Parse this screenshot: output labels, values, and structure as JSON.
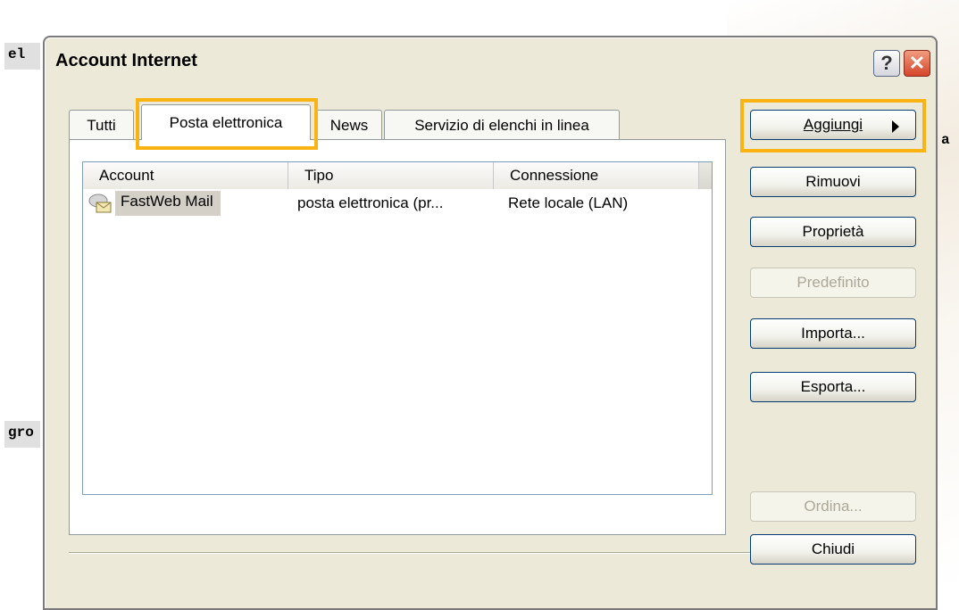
{
  "background": {
    "text_top_left": "el",
    "text_mid_left": "gro",
    "text_right": "a"
  },
  "dialog": {
    "title": "Account Internet",
    "help_label": "?",
    "close_label": "✕"
  },
  "tabs": [
    {
      "label": "Tutti"
    },
    {
      "label": "Posta elettronica"
    },
    {
      "label": "News"
    },
    {
      "label": "Servizio di elenchi in linea"
    }
  ],
  "list": {
    "columns": [
      "Account",
      "Tipo",
      "Connessione"
    ],
    "rows": [
      {
        "account": "FastWeb Mail",
        "tipo": "posta elettronica (pr...",
        "connessione": "Rete locale (LAN)"
      }
    ]
  },
  "buttons": {
    "aggiungi": "Aggiungi",
    "rimuovi": "Rimuovi",
    "proprieta": "Proprietà",
    "predefinito": "Predefinito",
    "importa": "Importa...",
    "esporta": "Esporta...",
    "ordina": "Ordina...",
    "chiudi": "Chiudi"
  },
  "icons": {
    "account_row": "mail-account-icon",
    "aggiungi_submenu": "triangle-right-icon"
  },
  "colors": {
    "highlight": "#F9B312",
    "dialog_face": "#ECE9D8",
    "close_button": "#d4452a"
  }
}
